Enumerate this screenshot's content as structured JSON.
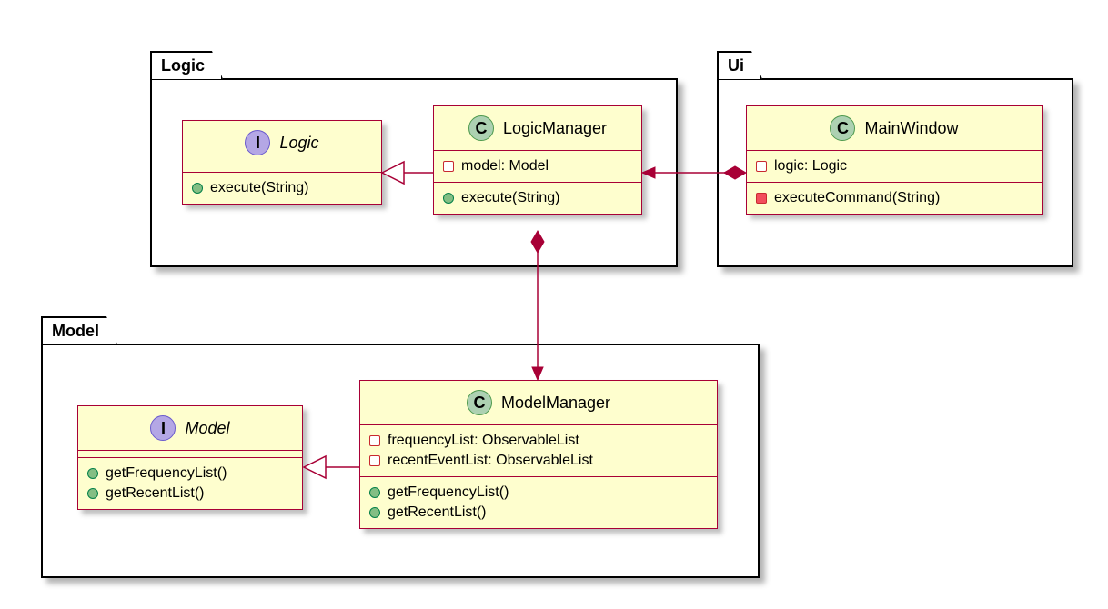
{
  "packages": {
    "logic": {
      "name": "Logic"
    },
    "ui": {
      "name": "Ui"
    },
    "model": {
      "name": "Model"
    }
  },
  "classes": {
    "logic_interface": {
      "stereotype": "I",
      "name": "Logic",
      "methods": [
        {
          "vis": "public",
          "sig": "execute(String)"
        }
      ]
    },
    "logic_manager": {
      "stereotype": "C",
      "name": "LogicManager",
      "fields": [
        {
          "vis": "private",
          "sig": "model: Model"
        }
      ],
      "methods": [
        {
          "vis": "public",
          "sig": "execute(String)"
        }
      ]
    },
    "main_window": {
      "stereotype": "C",
      "name": "MainWindow",
      "fields": [
        {
          "vis": "private",
          "sig": "logic: Logic"
        }
      ],
      "methods": [
        {
          "vis": "private-filled",
          "sig": "executeCommand(String)"
        }
      ]
    },
    "model_interface": {
      "stereotype": "I",
      "name": "Model",
      "methods": [
        {
          "vis": "public",
          "sig": "getFrequencyList()"
        },
        {
          "vis": "public",
          "sig": "getRecentList()"
        }
      ]
    },
    "model_manager": {
      "stereotype": "C",
      "name": "ModelManager",
      "fields": [
        {
          "vis": "private",
          "sig": "frequencyList: ObservableList"
        },
        {
          "vis": "private",
          "sig": "recentEventList: ObservableList"
        }
      ],
      "methods": [
        {
          "vis": "public",
          "sig": "getFrequencyList()"
        },
        {
          "vis": "public",
          "sig": "getRecentList()"
        }
      ]
    }
  }
}
